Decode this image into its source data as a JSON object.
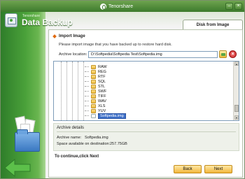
{
  "titlebar": {
    "brand": "Tenorshare",
    "minimize_glyph": "–",
    "close_glyph": "×"
  },
  "app": {
    "company": "Tenorshare",
    "name": "Data Backup"
  },
  "tab": {
    "label": "Disk from Image"
  },
  "section": {
    "title": "Import Image",
    "instruction": "Please import image that you have backed up to restore hard disk."
  },
  "location": {
    "label": "Archive location:",
    "value": "D:\\Softpedia\\Softpedia Test\\Softpedia.img"
  },
  "buttons": {
    "clear_glyph": "×",
    "back": "Back",
    "next": "Next"
  },
  "tree": {
    "items": [
      {
        "label": "RAW",
        "type": "folder"
      },
      {
        "label": "REG",
        "type": "folder"
      },
      {
        "label": "RTF",
        "type": "folder"
      },
      {
        "label": "SQL",
        "type": "folder"
      },
      {
        "label": "STL",
        "type": "folder"
      },
      {
        "label": "SWF",
        "type": "folder"
      },
      {
        "label": "TIFF",
        "type": "folder"
      },
      {
        "label": "WAV",
        "type": "folder"
      },
      {
        "label": "XLS",
        "type": "folder"
      },
      {
        "label": "YUV",
        "type": "folder"
      },
      {
        "label": "Softpedia.img",
        "type": "file",
        "selected": true
      }
    ],
    "scroll_up": "▲",
    "scroll_down": "▼"
  },
  "details": {
    "title": "Archive details",
    "name_label": "Archive name:",
    "name_value": "Softpedia.img",
    "space_label": "Space available on destination:",
    "space_value": "257.75GB"
  },
  "footer": {
    "continue_text": "To continue,click Next"
  },
  "colors": {
    "titlebar": "#4f8f3a",
    "accent_orange": "#e06a10",
    "selection": "#3d6fc8",
    "button": "#f2b63a"
  },
  "icons": {
    "app": "data-backup-icon",
    "browse": "browse-folder-icon",
    "clear": "clear-red-icon",
    "back": "back-arrow-icon"
  }
}
